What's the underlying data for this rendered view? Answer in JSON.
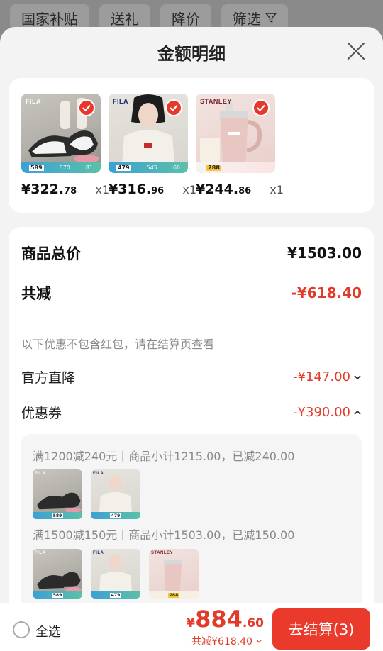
{
  "topbar": {
    "chips": [
      "国家补贴",
      "送礼",
      "降价",
      "筛选"
    ]
  },
  "sheet": {
    "title": "金额明细"
  },
  "products": [
    {
      "brand": "FILA",
      "strip_price": "589",
      "strip_a": "670",
      "strip_b": "81",
      "price_main": "¥322.",
      "price_dec": "78",
      "qty": "x1"
    },
    {
      "brand": "FILA",
      "strip_price": "479",
      "strip_a": "545",
      "strip_b": "66",
      "price_main": "¥316.",
      "price_dec": "96",
      "qty": "x1"
    },
    {
      "brand": "STANLEY",
      "strip_price": "288",
      "strip_a": "",
      "strip_b": "",
      "price_main": "¥244.",
      "price_dec": "86",
      "qty": "x1"
    }
  ],
  "summary": {
    "goods_total_label": "商品总价",
    "goods_total_value": "¥1503.00",
    "discount_label": "共减",
    "discount_value": "-¥618.40",
    "note": "以下优惠不包含红包，请在结算页查看",
    "official_label": "官方直降",
    "official_value": "-¥147.00",
    "coupon_label": "优惠券",
    "coupon_value": "-¥390.00"
  },
  "coupons": [
    {
      "text": "满1200减240元丨商品小计1215.00，已减240.00"
    },
    {
      "text": "满1500减150元丨商品小计1503.00，已减150.00"
    }
  ],
  "bottom": {
    "select_all": "全选",
    "currency": "¥",
    "total_int": "884",
    "total_dec": ".60",
    "saved": "共减¥618.40",
    "checkout": "去结算(3)"
  },
  "colors": {
    "accent_red": "#e23b2a",
    "button_red": "#ea3a2c"
  }
}
